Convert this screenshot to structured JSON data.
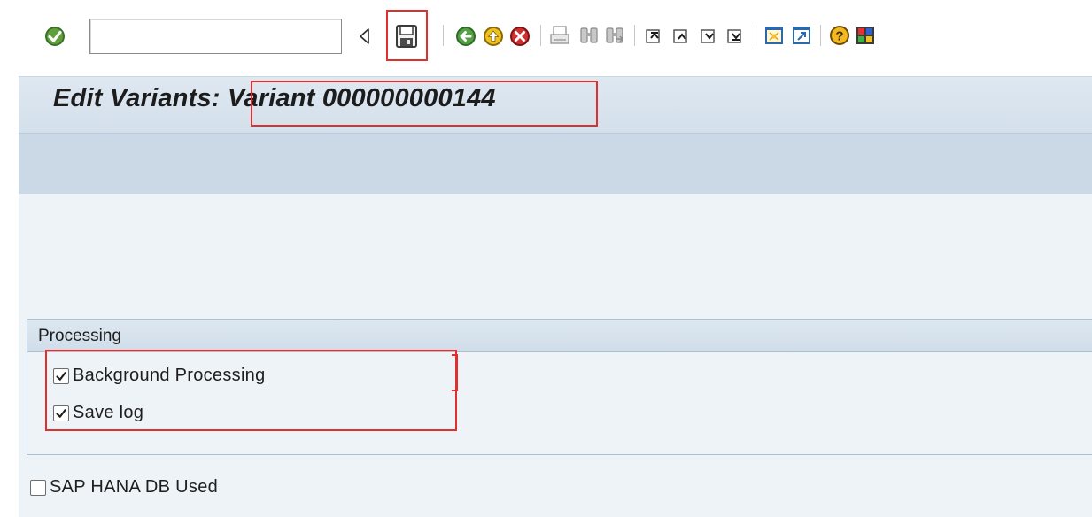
{
  "toolbar": {
    "command_field": {
      "value": "",
      "placeholder": ""
    },
    "buttons": [
      "enter-icon",
      "back-nav-icon",
      "save-icon",
      "back-icon",
      "exit-icon",
      "cancel-icon",
      "print-icon",
      "find-icon",
      "find-next-icon",
      "first-page-icon",
      "previous-page-icon",
      "next-page-icon",
      "last-page-icon",
      "create-session-icon",
      "shortcut-icon",
      "help-icon",
      "customize-layout-icon"
    ],
    "highlight_color": "#e0302e"
  },
  "title": {
    "prefix": "Edit Variants:",
    "variant": "Variant 000000000144"
  },
  "processing": {
    "group_title": "Processing",
    "background_processing": {
      "label": "Background Processing",
      "checked": true
    },
    "save_log": {
      "label": "Save log",
      "checked": true
    }
  },
  "hana": {
    "label": "SAP HANA DB Used",
    "checked": false
  },
  "colors": {
    "title_bar": "#d8e3ee",
    "app_toolbar": "#cbd9e6",
    "content": "#eef3f8",
    "highlight": "#e0302e"
  }
}
